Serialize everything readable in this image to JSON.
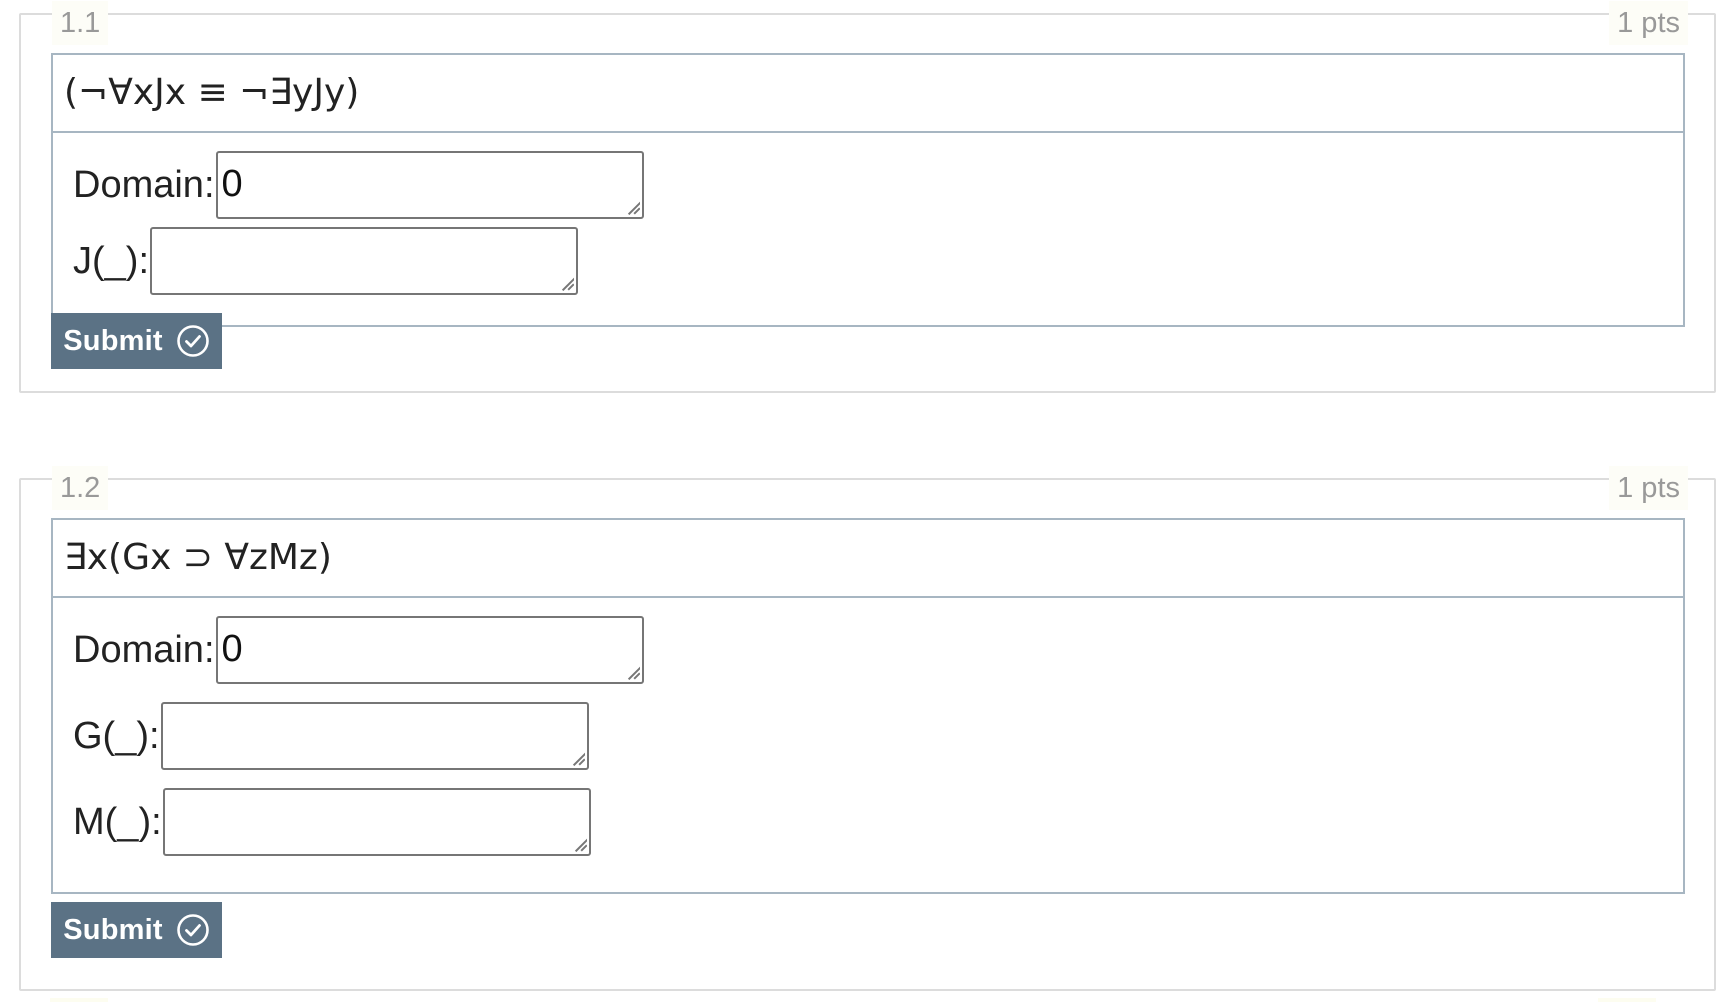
{
  "questions": [
    {
      "number": "1.1",
      "points": "1 pts",
      "formula": "(¬∀xJx ≡ ¬∃yJy)",
      "fields": [
        {
          "label": "Domain:",
          "value": "0"
        },
        {
          "label": "J(_):",
          "value": ""
        }
      ],
      "submit_label": "Submit"
    },
    {
      "number": "1.2",
      "points": "1 pts",
      "formula": "∃x(Gx ⊃ ∀zMz)",
      "fields": [
        {
          "label": "Domain:",
          "value": "0"
        },
        {
          "label": "G(_):",
          "value": ""
        },
        {
          "label": "M(_):",
          "value": ""
        }
      ],
      "submit_label": "Submit"
    }
  ],
  "colors": {
    "submit_background": "#5b7285",
    "panel_border": "#a7b6c2",
    "card_border": "#dcdcdc",
    "muted_text": "#999999"
  },
  "icons": {
    "submit": "check-circle-icon"
  }
}
